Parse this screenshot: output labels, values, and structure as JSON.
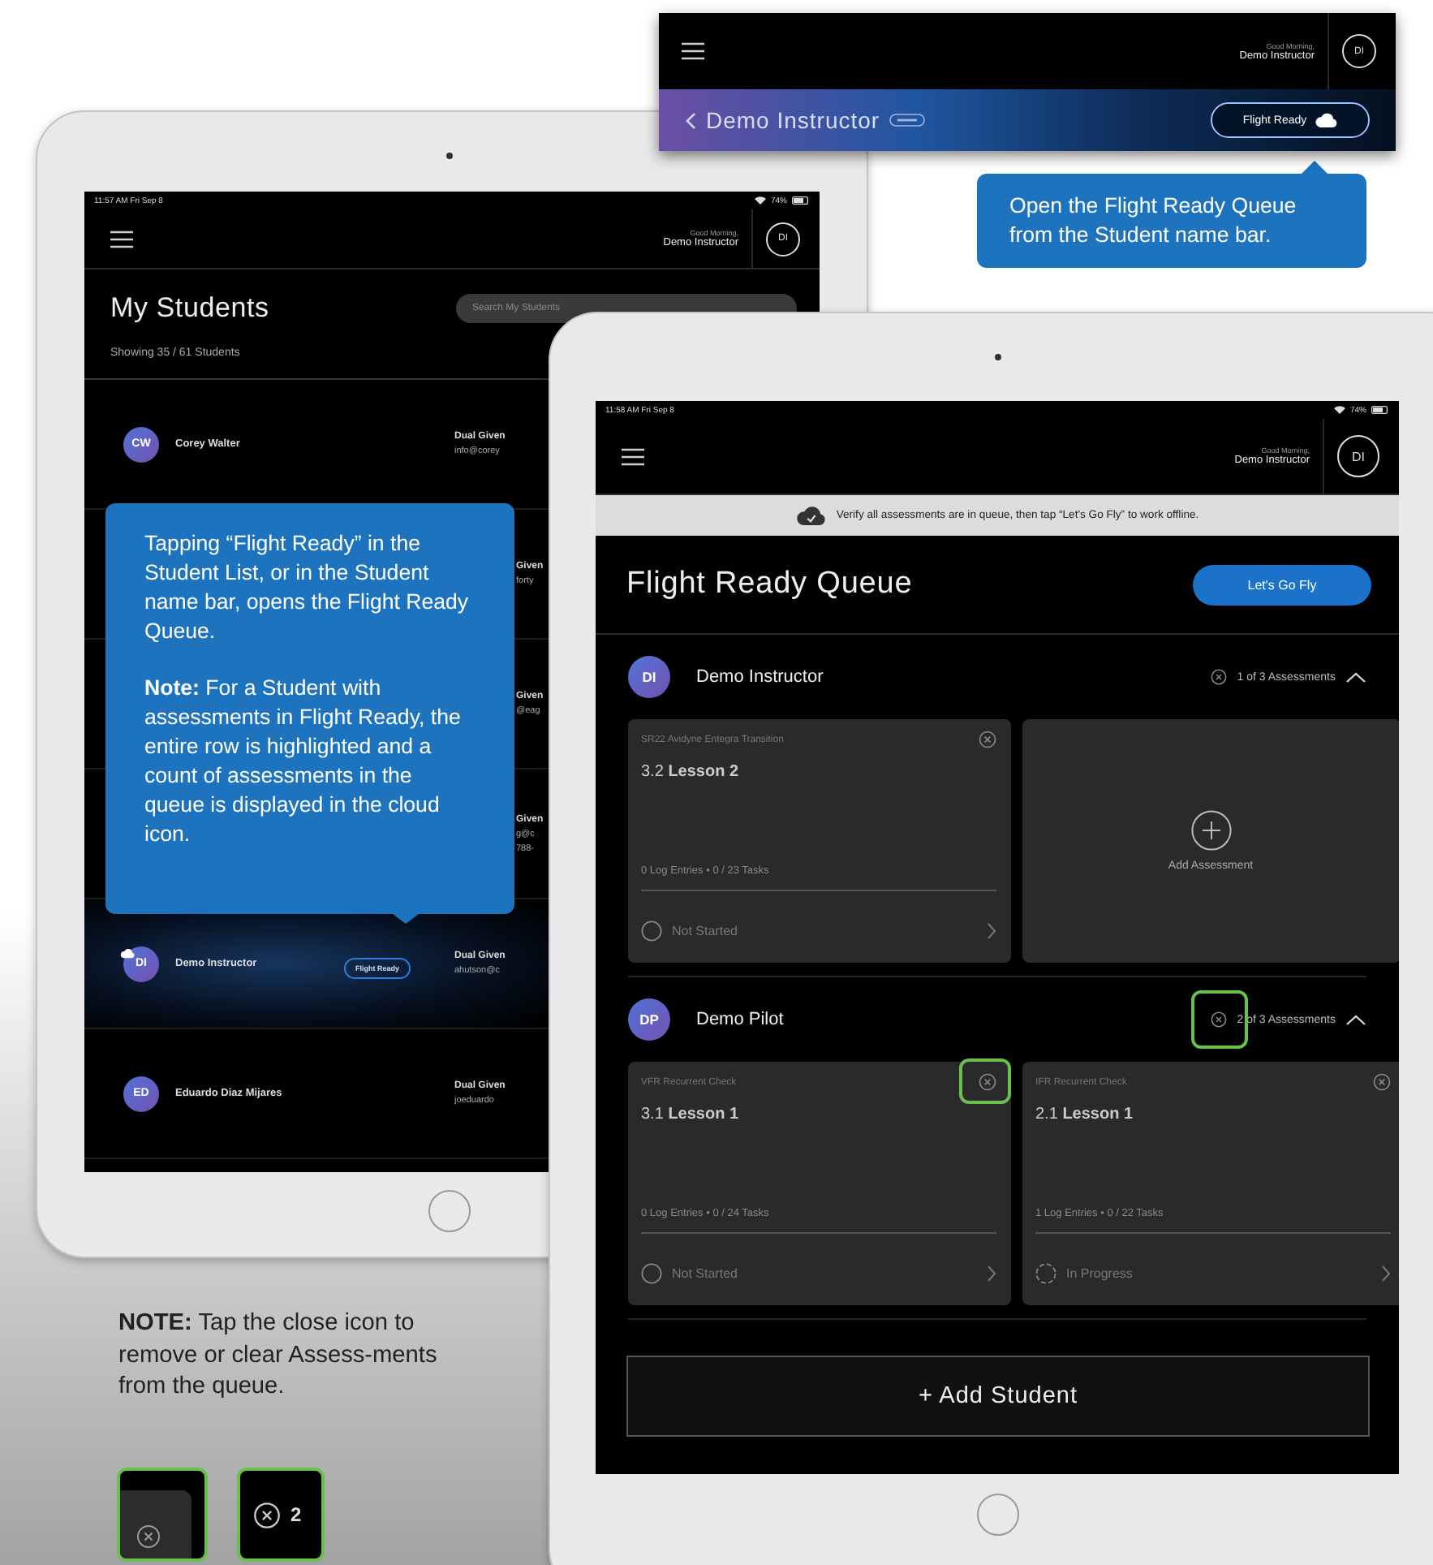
{
  "name_bar": {
    "greeting": "Good Morning,",
    "user": "Demo Instructor",
    "avatar": "DI",
    "student": "Demo Instructor",
    "button": "Flight Ready"
  },
  "name_bar_callout": "Open the Flight Ready Queue from the Student name bar.",
  "student_list": {
    "time": "11:57 AM  Fri Sep 8",
    "battery": "74%",
    "greeting": "Good Morning,",
    "user": "Demo Instructor",
    "avatar": "DI",
    "title": "My Students",
    "search_placeholder": "Search My Students",
    "count": "Showing 35 / 61 Students",
    "rows": [
      {
        "kind": "student",
        "initials": "CW",
        "name": "Corey Walter",
        "in_queue": false,
        "role": "Dual Given",
        "contact": "info@corey"
      },
      {
        "kind": "covered",
        "role": "Given",
        "contact": "forty"
      },
      {
        "kind": "covered",
        "role": "Given",
        "contact": "@eag"
      },
      {
        "kind": "covered",
        "role": "Given",
        "contact": "g@c",
        "phone": "788-"
      },
      {
        "kind": "student",
        "initials": "DI",
        "name": "Demo Instructor",
        "in_queue": true,
        "pill": "Flight Ready",
        "role": "Dual Given",
        "contact": "ahutson@c"
      },
      {
        "kind": "student",
        "initials": "ED",
        "name": "Eduardo Diaz Mijares",
        "in_queue": false,
        "role": "Dual Given",
        "contact": "joeduardo"
      }
    ]
  },
  "list_callout": {
    "text": "Tapping “Flight Ready” in the Student List, or in the Student name bar, opens the Flight Ready Queue.",
    "note": "**Note:** For a Student with assessments in Flight Ready, the entire row is highlighted and a count of assessments in the queue is displayed in the cloud icon."
  },
  "queue": {
    "time": "11:58 AM  Fri Sep 8",
    "battery": "74%",
    "greeting": "Good Morning,",
    "user": "Demo Instructor",
    "avatar": "DI",
    "banner": "Verify all assessments are in queue, then tap “Let's Go Fly” to work offline.",
    "title": "Flight Ready Queue",
    "go_button": "Let's Go Fly",
    "sections": [
      {
        "initials": "DI",
        "name": "Demo Instructor",
        "count": "1 of 3 Assessments",
        "expanded": true,
        "highlighted": false,
        "cards": [
          {
            "kind": "assessment",
            "course": "SR22 Avidyne Entegra Transition",
            "title": "3.2 **Lesson 2**",
            "meta": "0 Log Entries  •  0 / 23 Tasks",
            "status": "Not Started",
            "started": false,
            "highlighted": false
          },
          {
            "kind": "add",
            "label": "Add Assessment"
          }
        ]
      },
      {
        "initials": "DP",
        "name": "Demo Pilot",
        "count": "2 of 3 Assessments",
        "expanded": true,
        "highlighted": true,
        "cards": [
          {
            "kind": "assessment",
            "course": "VFR Recurrent Check",
            "title": "3.1 **Lesson 1**",
            "meta": "0 Log Entries  •  0 / 24 Tasks",
            "status": "Not Started",
            "started": false,
            "highlighted": true
          },
          {
            "kind": "assessment",
            "course": "IFR Recurrent Check",
            "title": "2.1 **Lesson 1**",
            "meta": "1 Log Entries  •  0 / 22 Tasks",
            "status": "In Progress",
            "started": true,
            "highlighted": false
          }
        ]
      }
    ],
    "add_student": "+ Add Student"
  },
  "note": {
    "text": "**NOTE:** Tap the close icon to remove or clear Assess-ments from the queue.",
    "thumbnails": [
      {
        "kind": "card_corner"
      },
      {
        "kind": "count",
        "text": "2"
      }
    ]
  }
}
